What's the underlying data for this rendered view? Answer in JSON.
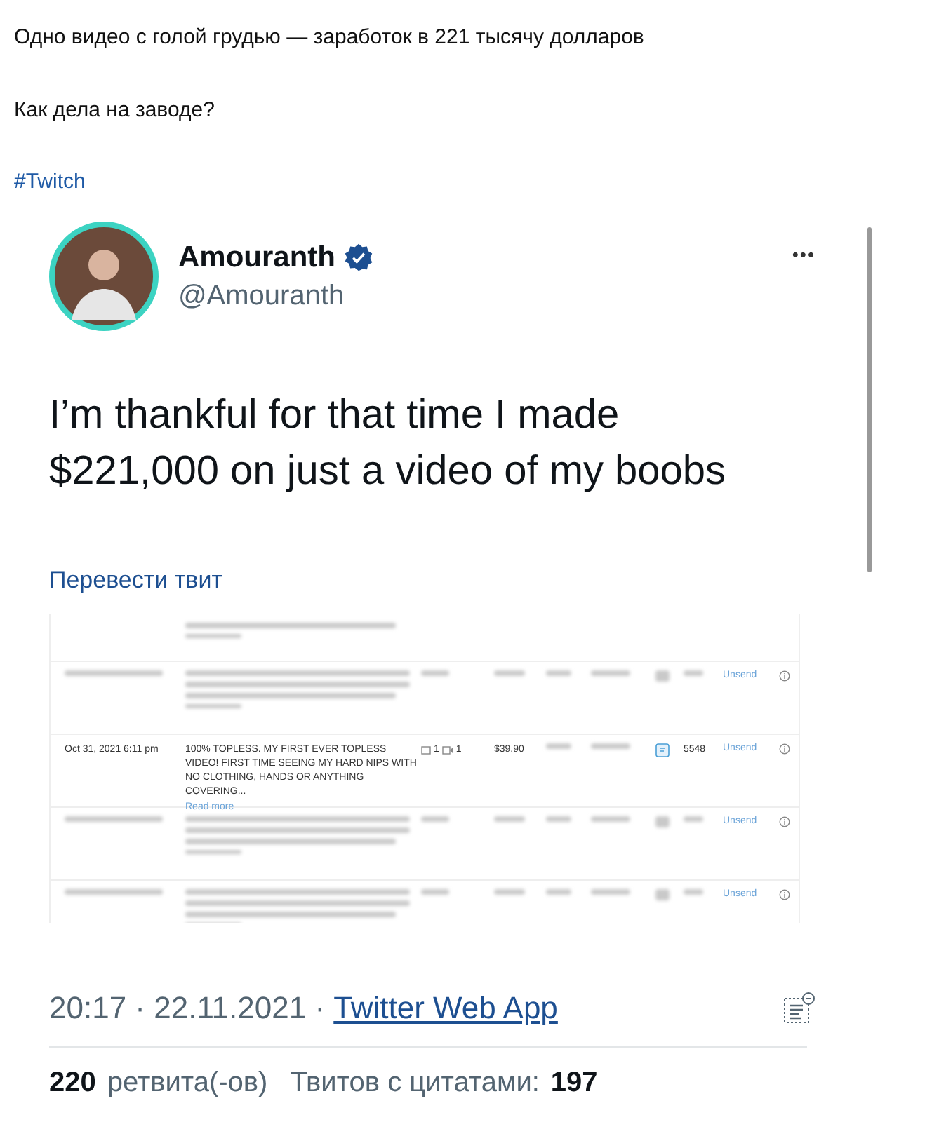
{
  "post": {
    "title": "Одно видео с голой грудью — заработок в 221 тысячу долларов",
    "subtitle": "Как дела на заводе?",
    "tag": "#Twitch"
  },
  "tweet": {
    "name": "Amouranth",
    "verified": true,
    "handle": "@Amouranth",
    "more": "•••",
    "text": [
      "I’m thankful for that time I made",
      "$221,000 on just a video of my boobs"
    ],
    "translate": "Перевести твит",
    "screenshot": {
      "rows": [
        {
          "kind": "partial",
          "unsend": ""
        },
        {
          "kind": "blurred",
          "unsend": "Unsend"
        },
        {
          "kind": "clear",
          "date": "Oct 31, 2021 6:11 pm",
          "text": "100% TOPLESS. MY FIRST EVER TOPLESS VIDEO! FIRST TIME SEEING MY HARD NIPS WITH NO CLOTHING, HANDS OR ANYTHING COVERING...",
          "read_more": "Read more",
          "media_a": "1",
          "media_b": "1",
          "price": "$39.90",
          "count": "5548",
          "unsend": "Unsend"
        },
        {
          "kind": "blurred",
          "unsend": "Unsend"
        },
        {
          "kind": "blurred",
          "unsend": "Unsend"
        }
      ]
    },
    "time": "20:17 · 22.11.2021 · ",
    "source": "Twitter Web App",
    "retweets": "220",
    "retweets_label": "ретвита(-ов)",
    "quotes_label": "Твитов с цитатами:",
    "quotes": "197"
  }
}
